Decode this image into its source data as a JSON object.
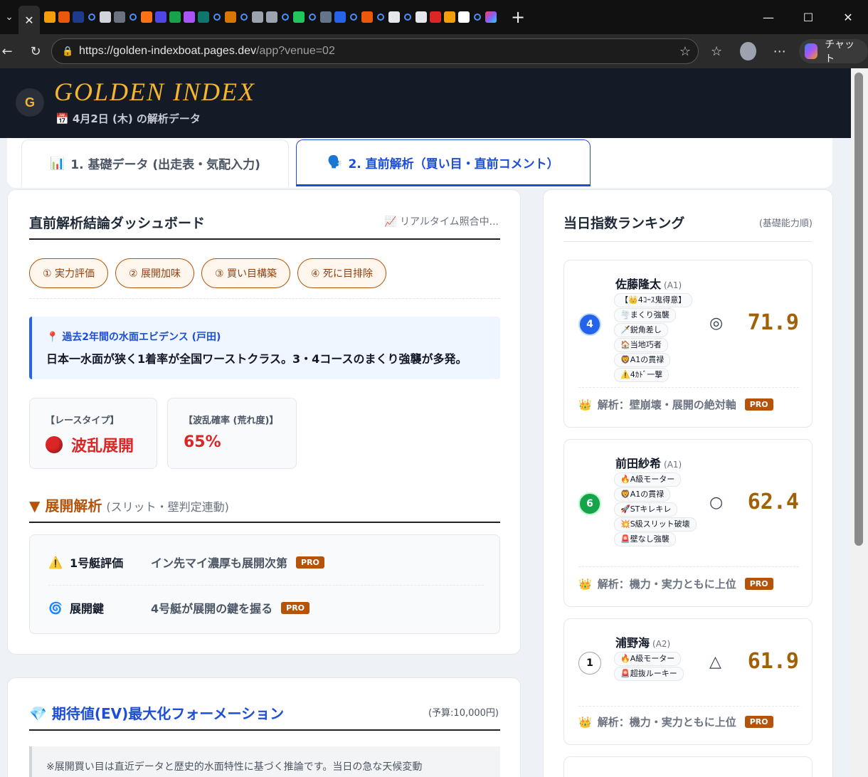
{
  "browser": {
    "url_host": "https://golden-indexboat.pages.dev",
    "url_path": "/app?venue=02",
    "copilot_label": "チャット"
  },
  "header": {
    "logo_letter": "G",
    "brand": "GOLDEN INDEX",
    "date_line": "4月2日 (木) の解析データ"
  },
  "tabs": [
    {
      "label": "1. 基礎データ (出走表・気配入力)",
      "icon": "chart-icon"
    },
    {
      "label": "2. 直前解析（買い目・直前コメント）",
      "icon": "speech-icon"
    }
  ],
  "dashboard": {
    "title": "直前解析結論ダッシュボード",
    "status": "リアルタイム照合中...",
    "steps": [
      "① 実力評価",
      "② 展開加味",
      "③ 買い目構築",
      "④ 死に目排除"
    ],
    "evidence_head": "過去2年間の水面エビデンス (戸田)",
    "evidence_body": "日本一水面が狭く1着率が全国ワーストクラス。3・4コースのまくり強襲が多発。",
    "race_type_label": "【レースタイプ】",
    "race_type_value": "波乱展開",
    "upset_label": "【波乱確率 (荒れ度)】",
    "upset_value": "65%",
    "dev_title": "▼ 展開解析",
    "dev_sub": "(スリット・壁判定連動)",
    "dev_rows": [
      {
        "key": "1号艇評価",
        "value": "イン先マイ濃厚も展開次第",
        "badge": "PRO"
      },
      {
        "key": "展開鍵",
        "value": "4号艇が展開の鍵を握る",
        "badge": "PRO"
      }
    ]
  },
  "ev": {
    "title": "期待値(EV)最大化フォーメーション",
    "budget": "(予算:10,000円)",
    "note": "※展開買い目は直近データと歴史的水面特性に基づく推論です。当日の急な天候変動"
  },
  "ranking": {
    "title": "当日指数ランキング",
    "sub": "(基礎能力順)",
    "items": [
      {
        "boat": "4",
        "name": "佐藤隆太",
        "class": "(A1)",
        "mark": "◎",
        "score": "71.9",
        "tags": [
          "【👑4ｺｰｽ鬼得意】",
          "🌪️まくり強襲",
          "🗡️鋭角差し",
          "🏠当地巧者",
          "🦁A1の貫禄",
          "⚠️4ｶﾄﾞ一撃"
        ],
        "analysis": "解析：壁崩壊・展開の絶対軸",
        "badge": "PRO"
      },
      {
        "boat": "6",
        "name": "前田紗希",
        "class": "(A1)",
        "mark": "○",
        "score": "62.4",
        "tags": [
          "🔥A級モーター",
          "🦁A1の貫禄",
          "🚀STキレキレ",
          "💥S級スリット破壊",
          "🚨壁なし強襲"
        ],
        "analysis": "解析：機力・実力ともに上位",
        "badge": "PRO"
      },
      {
        "boat": "1",
        "name": "浦野海",
        "class": "(A2)",
        "mark": "△",
        "score": "61.9",
        "tags": [
          "🔥A級モーター",
          "🚨超抜ルーキー"
        ],
        "analysis": "解析：機力・実力ともに上位",
        "badge": "PRO"
      }
    ]
  }
}
